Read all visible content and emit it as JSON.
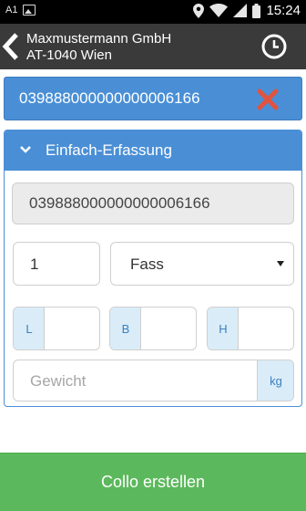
{
  "status_bar": {
    "carrier_label": "A1",
    "time": "15:24",
    "icons": [
      "image-notification-icon",
      "location-icon",
      "wifi-icon",
      "signal-icon",
      "battery-icon"
    ]
  },
  "header": {
    "back_icon": "back-arrow-icon",
    "company_name": "Maxmustermann GmbH",
    "company_address": "AT-1040 Wien",
    "history_icon": "clock-icon"
  },
  "scan": {
    "barcode": "039888000000000006166",
    "clear_icon": "close-icon"
  },
  "panel": {
    "title": "Einfach-Erfassung",
    "barcode_value": "039888000000000006166",
    "quantity_value": "1",
    "package_type": "Fass",
    "dimensions": {
      "length_label": "L",
      "width_label": "B",
      "height_label": "H"
    },
    "weight_placeholder": "Gewicht",
    "weight_unit": "kg"
  },
  "actions": {
    "create_label": "Collo erstellen"
  },
  "colors": {
    "primary": "#4a8fd6",
    "success": "#5cb85c",
    "danger": "#e0533f",
    "appbar": "#3a3a3a"
  }
}
